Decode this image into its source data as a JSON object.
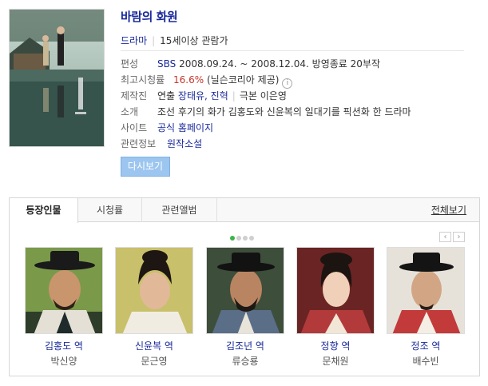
{
  "program": {
    "title": "바람의 화원",
    "genre": "드라마",
    "rating": "15세이상 관람가"
  },
  "info": {
    "schedule": {
      "label": "편성",
      "channel": "SBS",
      "dates": "2008.09.24. ~ 2008.12.04.",
      "status": "방영종료",
      "episodes": "20부작"
    },
    "viewership": {
      "label": "최고시청률",
      "value": "16.6%",
      "source": "(닐슨코리아 제공)",
      "icon": "info-icon",
      "icon_glyph": "i"
    },
    "staff": {
      "label": "제작진",
      "director_prefix": "연출",
      "directors": "장태유, 진혁",
      "writer_prefix": "극본",
      "writer": "이은영"
    },
    "synopsis": {
      "label": "소개",
      "text": "조선 후기의 화가 김홍도와 신윤복의 일대기를 픽션화 한 드라마"
    },
    "site": {
      "label": "사이트",
      "link": "공식 홈페이지"
    },
    "related": {
      "label": "관련정보",
      "link": "원작소설"
    }
  },
  "replay_button": "다시보기",
  "tabs": [
    {
      "label": "등장인물"
    },
    {
      "label": "시청률"
    },
    {
      "label": "관련앨범"
    }
  ],
  "view_all": "전체보기",
  "carousel": {
    "pages": 4,
    "current": 1,
    "prev_glyph": "‹",
    "next_glyph": "›"
  },
  "cast": [
    {
      "role": "김홍도 역",
      "actor": "박신양"
    },
    {
      "role": "신윤복 역",
      "actor": "문근영"
    },
    {
      "role": "김조년 역",
      "actor": "류승룡"
    },
    {
      "role": "정향 역",
      "actor": "문채원"
    },
    {
      "role": "정조 역",
      "actor": "배수빈"
    }
  ],
  "colors": {
    "link": "#1a2a9a",
    "rating_red": "#c8352c",
    "button": "#9cc6ef",
    "dot_active": "#3cb44a"
  }
}
